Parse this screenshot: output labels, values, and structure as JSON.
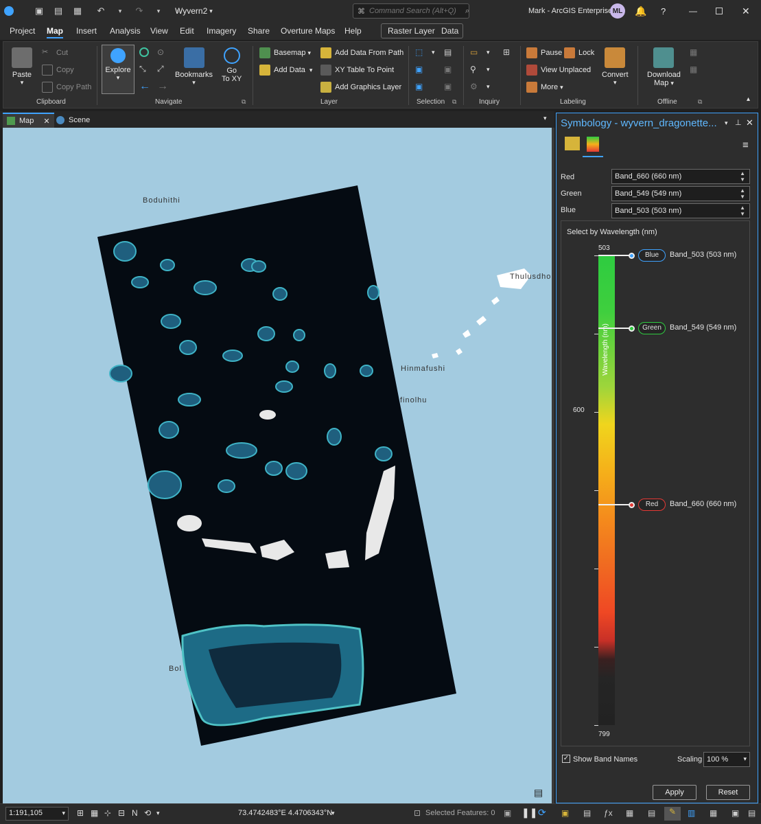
{
  "title_bar": {
    "project_name": "Wyvern2",
    "search_placeholder": "Command Search (Alt+Q)",
    "user": "Mark - ArcGIS Enterprise",
    "avatar_initials": "ML",
    "help": "?"
  },
  "ribbon_tabs": [
    "Project",
    "Map",
    "Insert",
    "Analysis",
    "View",
    "Edit",
    "Imagery",
    "Share",
    "Overture Maps",
    "Help",
    "Raster Layer",
    "Data"
  ],
  "ribbon": {
    "clipboard": {
      "paste": "Paste",
      "cut": "Cut",
      "copy": "Copy",
      "copy_path": "Copy Path",
      "label": "Clipboard"
    },
    "navigate": {
      "explore": "Explore",
      "bookmarks": "Bookmarks",
      "go_to_xy_1": "Go",
      "go_to_xy_2": "To XY",
      "label": "Navigate"
    },
    "layer": {
      "basemap": "Basemap",
      "add_data": "Add Data",
      "add_from_path": "Add Data From Path",
      "xy_table": "XY Table To Point",
      "graphics": "Add Graphics Layer",
      "label": "Layer"
    },
    "selection": {
      "label": "Selection"
    },
    "inquiry": {
      "label": "Inquiry"
    },
    "labeling": {
      "pause": "Pause",
      "lock": "Lock",
      "view_unplaced": "View Unplaced",
      "more": "More",
      "convert": "Convert",
      "label": "Labeling"
    },
    "offline": {
      "download_1": "Download",
      "download_2": "Map",
      "label": "Offline"
    }
  },
  "view_tabs": {
    "map": "Map",
    "scene": "Scene"
  },
  "map": {
    "places": [
      "Boduhithi",
      "Thulusdho",
      "Hinmafushi",
      "finolhu",
      "Bol"
    ]
  },
  "status_bar": {
    "scale": "1:191,105",
    "coordinates": "73.4742483°E 4.4706343°N",
    "selected_features": "Selected Features: 0"
  },
  "symbology": {
    "title": "Symbology - wyvern_dragonette...",
    "red_label": "Red",
    "green_label": "Green",
    "blue_label": "Blue",
    "red_value": "Band_660 (660 nm)",
    "green_value": "Band_549 (549 nm)",
    "blue_value": "Band_503 (503 nm)",
    "wavelength_title": "Select by Wavelength (nm)",
    "axis_label": "Wavelength (nm)",
    "min": "503",
    "mid": "600",
    "max": "799",
    "wavelength_range": [
      503,
      799
    ],
    "bands": [
      {
        "pill": "Blue",
        "name": "Band_503 (503 nm)",
        "wavelength": 503,
        "color": "#3fa3ff"
      },
      {
        "pill": "Green",
        "name": "Band_549 (549 nm)",
        "wavelength": 549,
        "color": "#2ecc40"
      },
      {
        "pill": "Red",
        "name": "Band_660 (660 nm)",
        "wavelength": 660,
        "color": "#e53935"
      }
    ],
    "show_band_names": "Show Band Names",
    "scaling_label": "Scaling",
    "scaling_value": "100 %",
    "apply": "Apply",
    "reset": "Reset"
  },
  "colors": {
    "accent": "#3fa3ff",
    "water": "#a3cbe0",
    "panel": "#2d2d2d"
  }
}
